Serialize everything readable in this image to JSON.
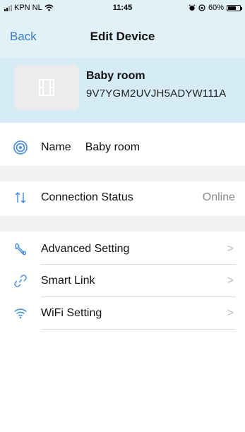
{
  "status_bar": {
    "carrier": "KPN NL",
    "time": "11:45",
    "battery": "60%"
  },
  "nav": {
    "back_label": "Back",
    "title": "Edit Device"
  },
  "device": {
    "name": "Baby room",
    "id": "9V7YGM2UVJH5ADYW111A"
  },
  "rows": {
    "name": {
      "label": "Name",
      "value": "Baby room"
    },
    "connection": {
      "label": "Connection Status",
      "value": "Online"
    },
    "advanced": {
      "label": "Advanced Setting",
      "chevron": ">"
    },
    "smart_link": {
      "label": "Smart Link",
      "chevron": ">"
    },
    "wifi": {
      "label": "WiFi Setting",
      "chevron": ">"
    }
  },
  "colors": {
    "accent": "#3b7bc6",
    "header_bg": "#e2f1f8",
    "device_bg": "#d5ecf6",
    "icon_blue": "#3f8de0"
  }
}
